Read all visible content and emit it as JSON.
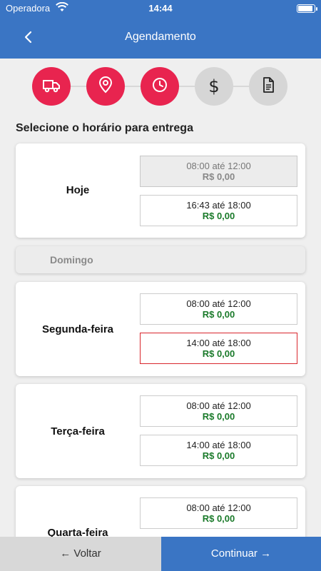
{
  "statusbar": {
    "carrier": "Operadora",
    "time": "14:44",
    "battery_level": 0.9
  },
  "header": {
    "title": "Agendamento",
    "back_icon": "chevron-left-icon"
  },
  "steps": [
    {
      "name": "truck-icon",
      "state": "active"
    },
    {
      "name": "location-pin-icon",
      "state": "active"
    },
    {
      "name": "clock-icon",
      "state": "active"
    },
    {
      "name": "dollar-icon",
      "state": "inactive",
      "glyph": "$"
    },
    {
      "name": "document-icon",
      "state": "inactive"
    }
  ],
  "heading": "Selecione o horário para entrega",
  "days": [
    {
      "label": "Hoje",
      "slots": [
        {
          "time": "08:00 até 12:00",
          "price": "R$ 0,00",
          "state": "disabled"
        },
        {
          "time": "16:43 até 18:00",
          "price": "R$ 0,00",
          "state": "available"
        }
      ]
    },
    {
      "label": "Domingo",
      "closed": true
    },
    {
      "label": "Segunda-feira",
      "slots": [
        {
          "time": "08:00 até 12:00",
          "price": "R$ 0,00",
          "state": "available"
        },
        {
          "time": "14:00 até 18:00",
          "price": "R$ 0,00",
          "state": "selected"
        }
      ]
    },
    {
      "label": "Terça-feira",
      "slots": [
        {
          "time": "08:00 até 12:00",
          "price": "R$ 0,00",
          "state": "available"
        },
        {
          "time": "14:00 até 18:00",
          "price": "R$ 0,00",
          "state": "available"
        }
      ]
    },
    {
      "label": "Quarta-feira",
      "slots": [
        {
          "time": "08:00 até 12:00",
          "price": "R$ 0,00",
          "state": "available"
        }
      ]
    }
  ],
  "footer": {
    "back_label": "← Voltar",
    "continue_label": "Continuar →"
  },
  "colors": {
    "primary": "#3a75c4",
    "accent": "#e8244f",
    "price": "#1a7a2a",
    "selected_border": "#d9262c"
  }
}
